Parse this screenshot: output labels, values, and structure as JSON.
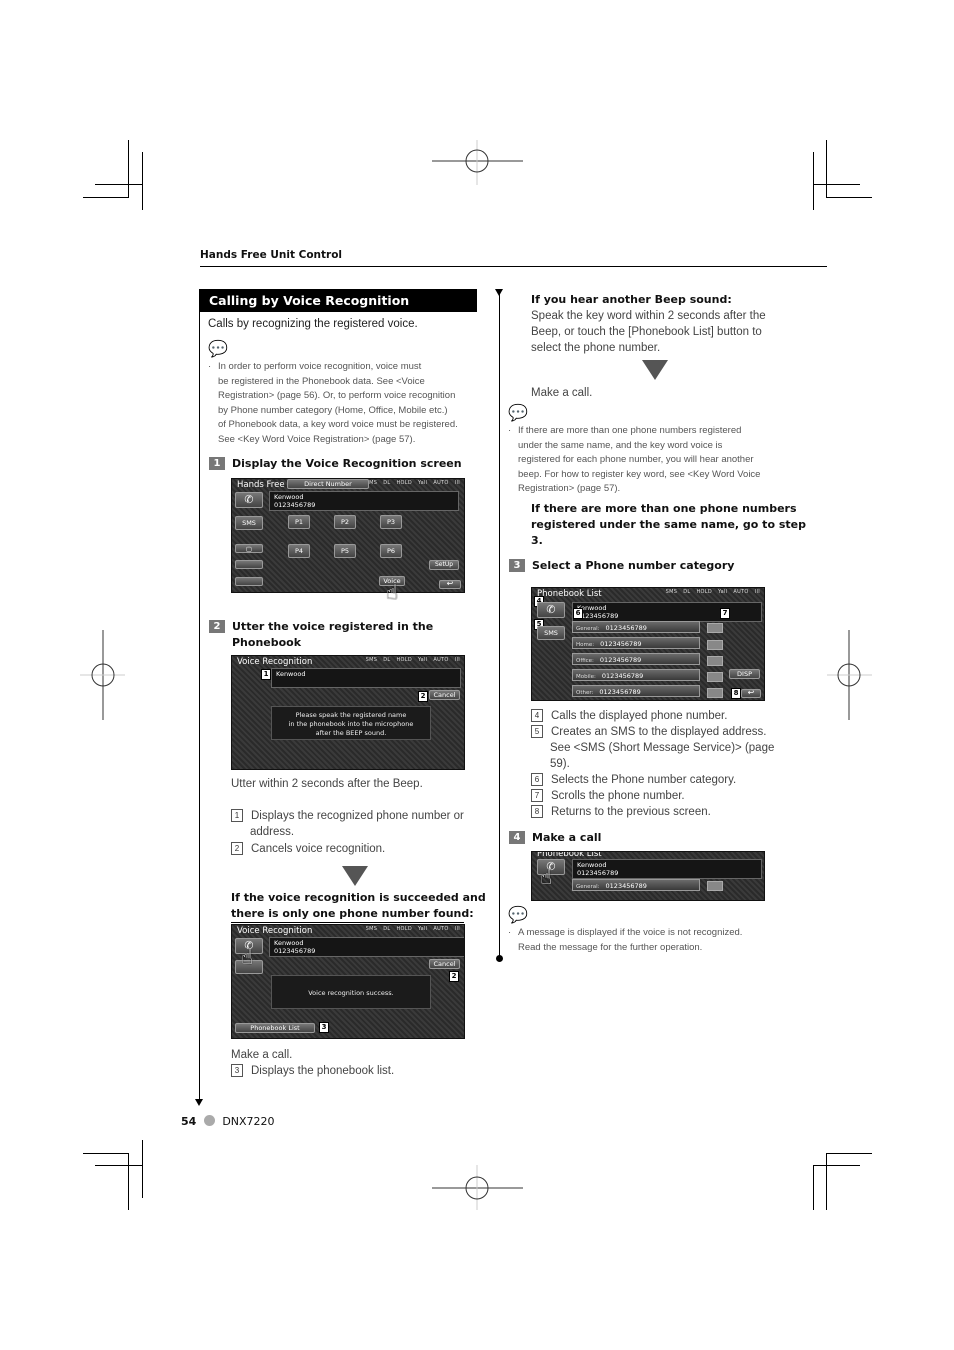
{
  "header": {
    "section_label": "Hands Free Unit Control"
  },
  "section": {
    "title": "Calling by Voice Recognition",
    "intro": "Calls by recognizing the registered voice.",
    "note_1": [
      "In order to perform voice recognition, voice must",
      "be registered in the Phonebook data. See <Voice",
      "Registration> (page 56). Or, to perform voice recognition",
      "by Phone number category (Home, Office, Mobile etc.)",
      "of Phonebook data, a key word voice must be registered.",
      "See <Key Word Voice Registration> (page 57)."
    ]
  },
  "steps": [
    {
      "num": "1",
      "title": "Display the Voice Recognition screen"
    },
    {
      "num": "2",
      "title_line1": "Utter the voice registered in the",
      "title_line2": "Phonebook"
    },
    {
      "num": "3",
      "title": "Select a Phone number category"
    },
    {
      "num": "4",
      "title": "Make a call"
    }
  ],
  "screen_hands_free": {
    "title": "Hands Free",
    "status": [
      "SMS",
      "DL",
      "HOLD",
      "Yall",
      "AUTO",
      "III"
    ],
    "name": "Kenwood",
    "number": "0123456789",
    "sms_label": "SMS",
    "presets": [
      "P1",
      "P2",
      "P3",
      "P4",
      "P5",
      "P6"
    ],
    "setup": "SetUp",
    "direct_number": "Direct Number",
    "voice": "Voice"
  },
  "screen_voice_rec": {
    "title": "Voice Recognition",
    "name": "Kenwood",
    "cancel": "Cancel",
    "message": [
      "Please speak the registered name",
      "in the phonebook into the microphone",
      "after the BEEP sound."
    ],
    "markers": [
      "1",
      "2"
    ]
  },
  "step2_text": {
    "utter": "Utter within 2 seconds after the Beep.",
    "items": [
      {
        "n": "1",
        "l1": "Displays the recognized phone number or",
        "l2": "address."
      },
      {
        "n": "2",
        "l1": "Cancels voice recognition."
      }
    ],
    "condition": [
      "If the voice recognition is succeeded and",
      "there is only one phone number found:"
    ]
  },
  "screen_success": {
    "title": "Voice Recognition",
    "name": "Kenwood",
    "number": "0123456789",
    "cancel": "Cancel",
    "message": "Voice recognition success.",
    "phonebook_list": "Phonebook List",
    "markers": [
      "2",
      "3"
    ]
  },
  "after_success": {
    "make_call": "Make a call.",
    "item": {
      "n": "3",
      "text": "Displays the phonebook list."
    }
  },
  "right_col": {
    "beep_head": "If you hear another Beep sound:",
    "beep_text": [
      "Speak the key word within 2 seconds after the",
      "Beep, or touch the [Phonebook List] button to",
      "select the phone number."
    ],
    "make_call": "Make a call.",
    "note_2": [
      "If there are more than one phone numbers registered",
      "under the same name, and the key word voice is",
      "registered for each phone number, you will hear another",
      "beep. For how to register key word, see <Key Word Voice",
      "Registration> (page 57)."
    ],
    "goto": [
      "If there are more than one phone numbers",
      "registered under the same name, go to step",
      "3."
    ],
    "step3_items": [
      {
        "n": "4",
        "l1": "Calls the displayed phone number."
      },
      {
        "n": "5",
        "l1": "Creates an SMS to the displayed address.",
        "l2": "See <SMS (Short Message Service)> (page",
        "l3": "59)."
      },
      {
        "n": "6",
        "l1": "Selects the Phone number category."
      },
      {
        "n": "7",
        "l1": "Scrolls the phone number."
      },
      {
        "n": "8",
        "l1": "Returns to the previous screen."
      }
    ],
    "note_3": [
      "A message is displayed if the voice is not recognized.",
      "Read the message for the further operation."
    ]
  },
  "screen_phonebook": {
    "title": "Phonebook List",
    "name": "Kenwood",
    "number": "0123456789",
    "sms": "SMS",
    "rows": [
      {
        "cat": "General:",
        "num": "0123456789"
      },
      {
        "cat": "Home:",
        "num": "0123456789"
      },
      {
        "cat": "Office:",
        "num": "0123456789"
      },
      {
        "cat": "Mobile:",
        "num": "0123456789"
      },
      {
        "cat": "Other:",
        "num": "0123456789"
      }
    ],
    "disp": "DISP",
    "markers": [
      "4",
      "5",
      "6",
      "7",
      "8"
    ]
  },
  "footer": {
    "page": "54",
    "model": "DNX7220"
  }
}
